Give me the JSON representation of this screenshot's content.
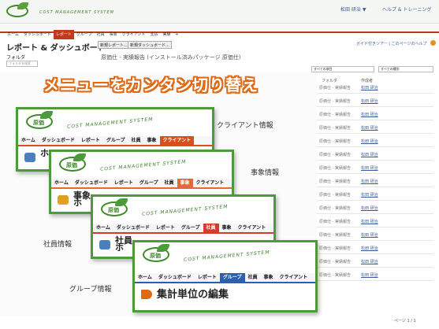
{
  "topbar": {
    "user": "松田 研治 ▼",
    "help": "ヘルプ & トレーニング",
    "logo_text": "COST MANAGEMENT SYSTEM"
  },
  "nav": {
    "items": [
      "ホーム",
      "ダッシュボード",
      "レポート",
      "グループ",
      "社員",
      "事象",
      "クライアント",
      "支払",
      "実績",
      "+"
    ],
    "active_index": 2
  },
  "page": {
    "title": "レポート & ダッシュボード",
    "new_report_button": "新規レポート...",
    "new_dashboard_button": "新規ダッシュボード...",
    "breadcrumb": "原価仕 - 実績報告 (インストール済みパッケージ 原価仕)",
    "help_links": "ガイド付きツアー | このページのヘルプ",
    "folder_label": "フォルダ",
    "folder_search_placeholder": "フォルダを検索",
    "sort_select": "すべての項目",
    "type_select": "すべての種別",
    "col_folder": "フォルダ",
    "col_creator": "作成者",
    "folder_cell": "原価仕 - 実績報告",
    "creator_cell": "松田 研治",
    "pager": "ページ 1 / 1"
  },
  "headline": "メニューをカンタン切り替え",
  "cards": [
    {
      "caption": "クライアント情報",
      "nav": [
        "ホーム",
        "ダッシュボード",
        "レポート",
        "グループ",
        "社員",
        "事象",
        "クライアント"
      ],
      "active": 6,
      "page_title": "ホ",
      "color": "#d94f1a"
    },
    {
      "caption": "事象情報",
      "nav": [
        "ホーム",
        "ダッシュボード",
        "レポート",
        "グループ",
        "社員",
        "事象",
        "クライアント"
      ],
      "active": 5,
      "page_title": "事象\nホ",
      "color": "#e06a3a"
    },
    {
      "caption": "社員情報",
      "nav": [
        "ホーム",
        "ダッシュボード",
        "レポート",
        "グループ",
        "社員",
        "事象",
        "クライアント"
      ],
      "active": 4,
      "page_title": "社員\nホ",
      "color": "#d9382a"
    },
    {
      "caption": "グループ情報",
      "nav": [
        "ホーム",
        "ダッシュボード",
        "レポート",
        "グループ",
        "社員",
        "事象",
        "クライアント"
      ],
      "active": 3,
      "page_title": "集計単位の編集",
      "color": "#2b5fb0"
    }
  ],
  "brand": {
    "logo_label": "原価",
    "system_name": "COST MANAGEMENT SYSTEM",
    "green": "#4c9a3b",
    "orange": "#e06a14"
  }
}
